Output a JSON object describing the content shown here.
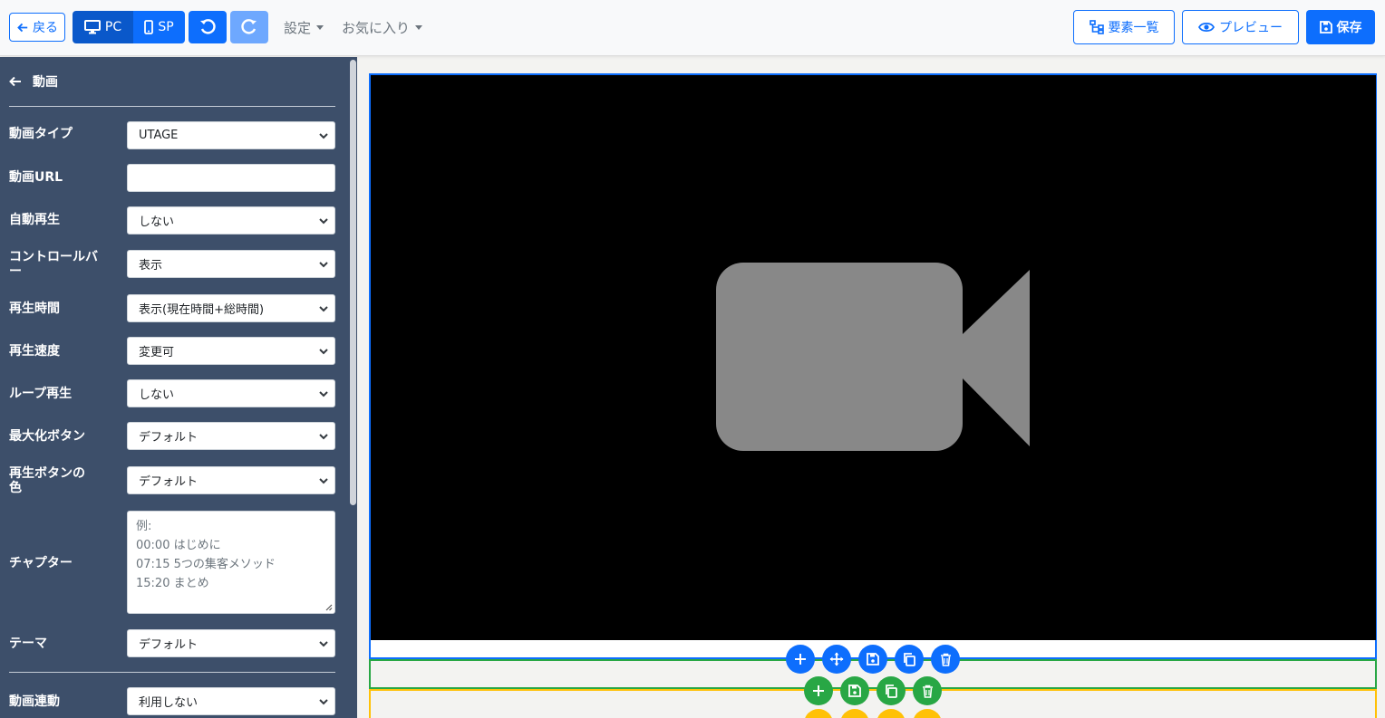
{
  "toolbar": {
    "back_label": "戻る",
    "device_pc_label": "PC",
    "device_sp_label": "SP",
    "settings_label": "設定",
    "favorites_label": "お気に入り",
    "elements_list_label": "要素一覧",
    "preview_label": "プレビュー",
    "save_label": "保存"
  },
  "sidebar": {
    "title": "動画",
    "fields": [
      {
        "label": "動画タイプ",
        "value": "UTAGE"
      },
      {
        "label": "動画URL",
        "value": ""
      },
      {
        "label": "自動再生",
        "value": "しない"
      },
      {
        "label": "コントロールバー",
        "value": "表示"
      },
      {
        "label": "再生時間",
        "value": "表示(現在時間+総時間)"
      },
      {
        "label": "再生速度",
        "value": "変更可"
      },
      {
        "label": "ループ再生",
        "value": "しない"
      },
      {
        "label": "最大化ボタン",
        "value": "デフォルト"
      },
      {
        "label": "再生ボタンの色",
        "value": "デフォルト"
      },
      {
        "label": "チャプター",
        "placeholder": [
          "例:",
          "00:00 はじめに",
          "07:15 5つの集客メソッド",
          "15:20 まとめ"
        ]
      },
      {
        "label": "テーマ",
        "value": "デフォルト"
      },
      {
        "label": "動画連動",
        "value": "利用しない"
      }
    ]
  },
  "colors": {
    "primary": "#0d6efd",
    "sidebar_bg": "#3d4f6a",
    "section_border": "#28a745",
    "row_border": "#ffc107",
    "video_placeholder": "#888888"
  }
}
